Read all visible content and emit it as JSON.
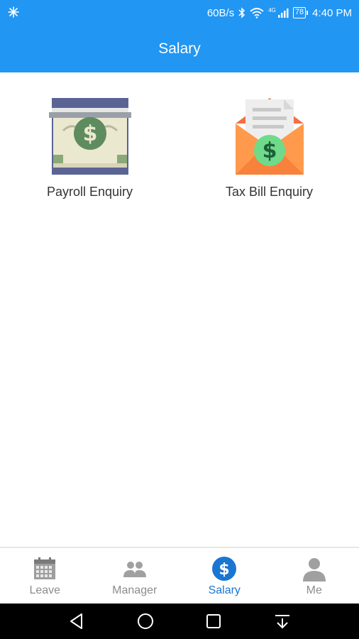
{
  "status_bar": {
    "speed": "60B/s",
    "network": "4G",
    "battery": "78",
    "time": "4:40 PM"
  },
  "app_bar": {
    "title": "Salary"
  },
  "tiles": [
    {
      "label": "Payroll Enquiry",
      "icon": "money-bill-icon"
    },
    {
      "label": "Tax Bill Enquiry",
      "icon": "tax-envelope-icon"
    }
  ],
  "tab_bar": {
    "active": "Salary",
    "active_color": "#1976D2",
    "inactive_color": "#8c8c8c",
    "items": [
      {
        "label": "Leave",
        "icon": "calendar-icon"
      },
      {
        "label": "Manager",
        "icon": "people-icon"
      },
      {
        "label": "Salary",
        "icon": "dollar-icon"
      },
      {
        "label": "Me",
        "icon": "person-icon"
      }
    ]
  },
  "colors": {
    "primary": "#2196F3"
  }
}
